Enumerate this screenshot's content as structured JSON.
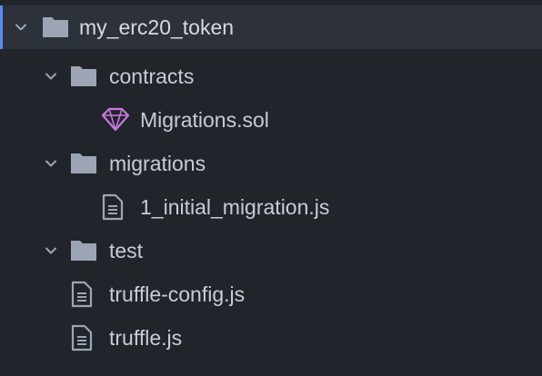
{
  "tree": {
    "root": {
      "name": "my_erc20_token",
      "icon": "folder-icon",
      "expanded": true
    },
    "items": [
      {
        "name": "contracts",
        "kind": "folder",
        "icon": "folder-icon",
        "expanded": true
      },
      {
        "name": "Migrations.sol",
        "kind": "file",
        "icon": "solidity-file-icon"
      },
      {
        "name": "migrations",
        "kind": "folder",
        "icon": "folder-icon",
        "expanded": true
      },
      {
        "name": "1_initial_migration.js",
        "kind": "file",
        "icon": "file-icon"
      },
      {
        "name": "test",
        "kind": "folder",
        "icon": "folder-icon",
        "expanded": true
      },
      {
        "name": "truffle-config.js",
        "kind": "file",
        "icon": "file-icon"
      },
      {
        "name": "truffle.js",
        "kind": "file",
        "icon": "file-icon"
      }
    ]
  },
  "colors": {
    "background": "#21252b",
    "selected_background": "#2c313a",
    "accent": "#568af2",
    "text": "#c7ccd6",
    "icon": "#9da5b4",
    "solidity_icon": "#c678dd"
  }
}
